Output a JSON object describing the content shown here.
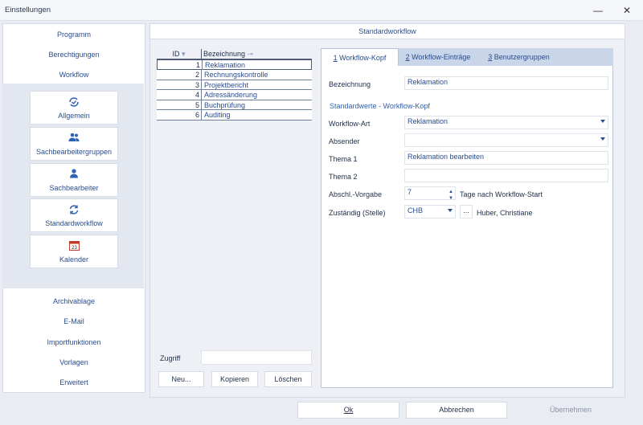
{
  "window": {
    "title": "Einstellungen",
    "minimize": "—",
    "close": "✕"
  },
  "leftnav": {
    "top_items": [
      "Programm",
      "Berechtigungen",
      "Workflow"
    ],
    "sub_items": [
      {
        "label": "Allgemein",
        "icon": "cycle-check-icon"
      },
      {
        "label": "Sachbearbeitergruppen",
        "icon": "group-icon"
      },
      {
        "label": "Sachbearbeiter",
        "icon": "user-icon"
      },
      {
        "label": "Standardworkflow",
        "icon": "refresh-icon"
      },
      {
        "label": "Kalender",
        "icon": "calendar-icon"
      }
    ],
    "bottom_items": [
      "Archivablage",
      "E-Mail",
      "Importfunktionen",
      "Vorlagen",
      "Erweitert"
    ]
  },
  "main": {
    "title": "Standardworkflow"
  },
  "list": {
    "col_id": "ID",
    "col_bez": "Bezeichnung",
    "rows": [
      {
        "id": "1",
        "text": "Reklamation"
      },
      {
        "id": "2",
        "text": "Rechnungskontrolle"
      },
      {
        "id": "3",
        "text": "Projektbericht"
      },
      {
        "id": "4",
        "text": "Adressänderung"
      },
      {
        "id": "5",
        "text": "Buchprüfung"
      },
      {
        "id": "6",
        "text": "Auditing"
      }
    ]
  },
  "zugriff": {
    "label": "Zugriff",
    "value": ""
  },
  "list_buttons": {
    "neu": "Neu...",
    "kopieren": "Kopieren",
    "loeschen": "Löschen"
  },
  "tabs": [
    {
      "num": "1",
      "label": " Workflow-Kopf"
    },
    {
      "num": "2",
      "label": " Workflow-Einträge"
    },
    {
      "num": "3",
      "label": " Benutzergruppen"
    }
  ],
  "form": {
    "bezeichnung_label": "Bezeichnung",
    "bezeichnung_value": "Reklamation",
    "section": "Standardwerte - Workflow-Kopf",
    "art_label": "Workflow-Art",
    "art_value": "Reklamation",
    "absender_label": "Absender",
    "absender_value": "",
    "thema1_label": "Thema 1",
    "thema1_value": "Reklamation bearbeiten",
    "thema2_label": "Thema 2",
    "thema2_value": "",
    "abschl_label": "Abschl.-Vorgabe",
    "abschl_value": "7",
    "abschl_suffix": "Tage nach Workflow-Start",
    "zustaendig_label": "Zuständig (Stelle)",
    "zustaendig_value": "CHB",
    "zustaendig_browse": "...",
    "zustaendig_name": "Huber, Christiane"
  },
  "footer": {
    "ok": "Ok",
    "abbrechen": "Abbrechen",
    "uebernehmen": "Übernehmen"
  }
}
